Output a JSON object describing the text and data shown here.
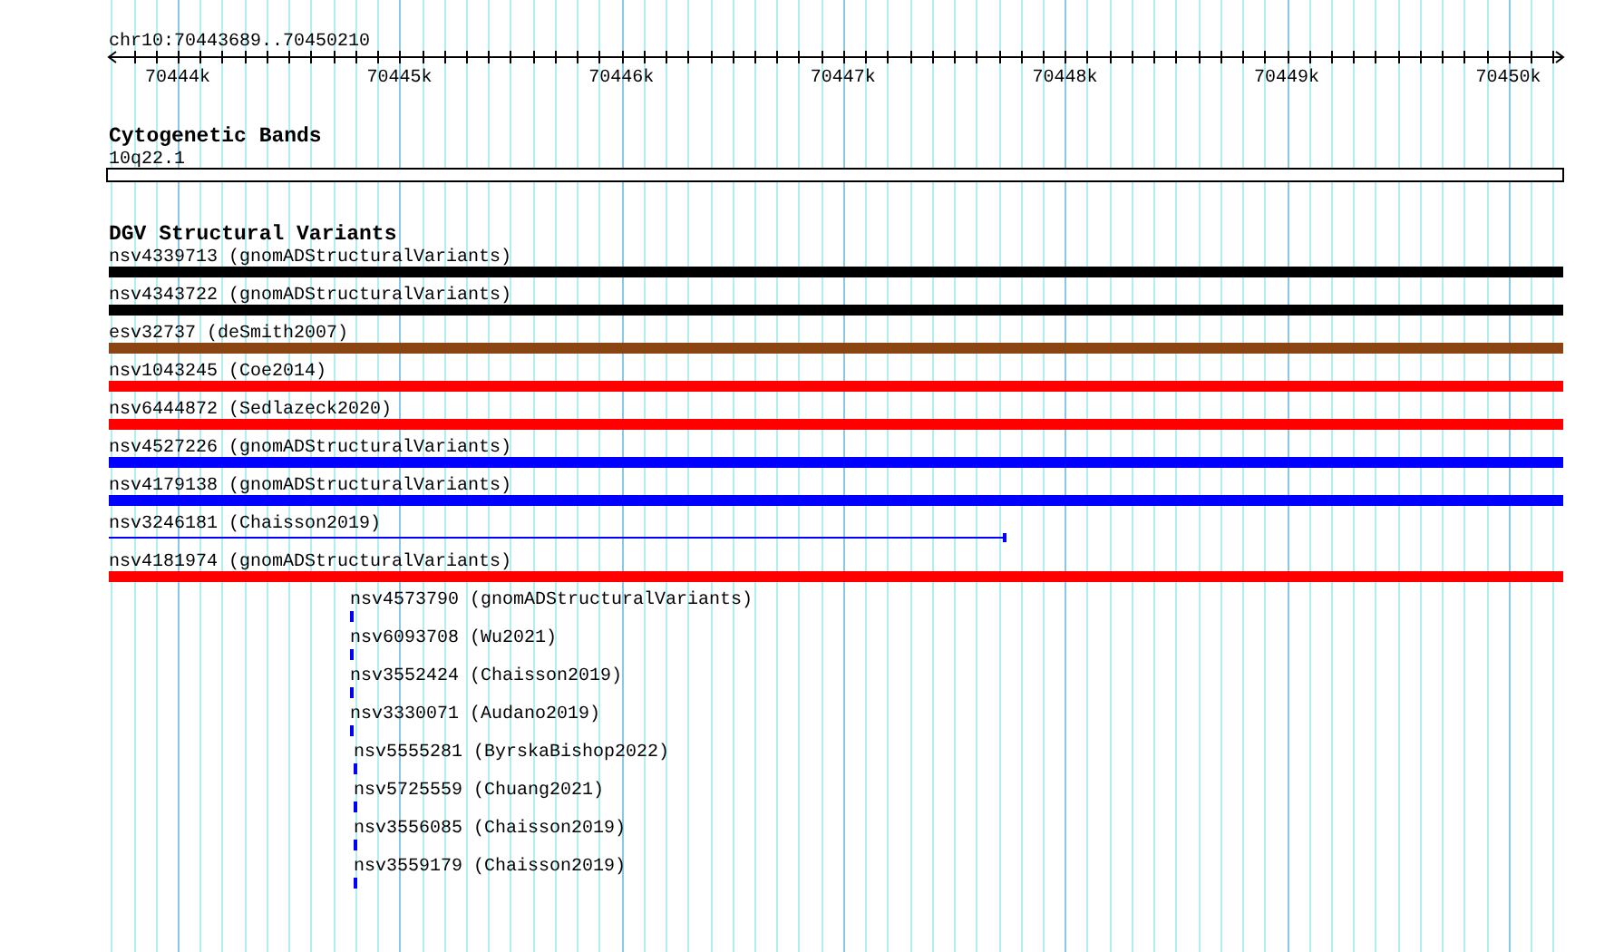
{
  "location": "chr10:70443689..70450210",
  "ruler": {
    "ticks": [
      "70444k",
      "70445k",
      "70446k",
      "70447k",
      "70448k",
      "70449k",
      "70450k"
    ]
  },
  "tracks": [
    {
      "kind": "bands",
      "title": "Cytogenetic Bands",
      "features": [
        {
          "label": "10q22.1",
          "kind": "band",
          "color": "#ffffff"
        }
      ]
    },
    {
      "kind": "variants",
      "title": "DGV Structural Variants",
      "features": [
        {
          "label": "nsv4339713 (gnomADStructuralVariants)",
          "kind": "bar",
          "color": "#000000"
        },
        {
          "label": "nsv4343722 (gnomADStructuralVariants)",
          "kind": "bar",
          "color": "#000000"
        },
        {
          "label": "esv32737 (deSmith2007)",
          "kind": "bar",
          "color": "#8b4513"
        },
        {
          "label": "nsv1043245 (Coe2014)",
          "kind": "bar",
          "color": "#ff0000"
        },
        {
          "label": "nsv6444872 (Sedlazeck2020)",
          "kind": "bar",
          "color": "#ff0000"
        },
        {
          "label": "nsv4527226 (gnomADStructuralVariants)",
          "kind": "bar",
          "color": "#0000ff"
        },
        {
          "label": "nsv4179138 (gnomADStructuralVariants)",
          "kind": "bar",
          "color": "#0000ff"
        },
        {
          "label": "nsv3246181 (Chaisson2019)",
          "kind": "line",
          "color": "#0000ff"
        },
        {
          "label": "nsv4181974 (gnomADStructuralVariants)",
          "kind": "bar",
          "color": "#ff0000"
        },
        {
          "label": "nsv4573790 (gnomADStructuralVariants)",
          "kind": "dash",
          "color": "#0000ff"
        },
        {
          "label": "nsv6093708 (Wu2021)",
          "kind": "dash",
          "color": "#0000ff"
        },
        {
          "label": "nsv3552424 (Chaisson2019)",
          "kind": "dash",
          "color": "#0000ff"
        },
        {
          "label": "nsv3330071 (Audano2019)",
          "kind": "dash",
          "color": "#0000ff"
        },
        {
          "label": "nsv5555281 (ByrskaBishop2022)",
          "kind": "dash",
          "color": "#0000ff"
        },
        {
          "label": "nsv5725559 (Chuang2021)",
          "kind": "dash",
          "color": "#0000ff"
        },
        {
          "label": "nsv3556085 (Chaisson2019)",
          "kind": "dash",
          "color": "#0000ff"
        },
        {
          "label": "nsv3559179 (Chaisson2019)",
          "kind": "dash",
          "color": "#0000ff"
        }
      ]
    }
  ]
}
